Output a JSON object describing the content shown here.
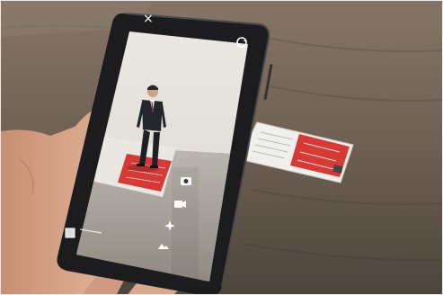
{
  "photo": {
    "scene": "photo",
    "colors": {
      "table": "#6d5f52",
      "table_dark": "#4d443b",
      "card_red": "#d63a36",
      "screen_wall": "#e4e1dc",
      "phone_body": "#1c1c1e",
      "skin": "#d5a387"
    }
  },
  "phone_ui": {
    "close_icon_glyph": "×",
    "switch_camera_icon": "camera-switch-icon",
    "side_icons": [
      "camera-icon",
      "video-icon",
      "sparkle-icon",
      "landscape-icon"
    ],
    "thumbnail_icon": "gallery-thumbnail-icon"
  }
}
